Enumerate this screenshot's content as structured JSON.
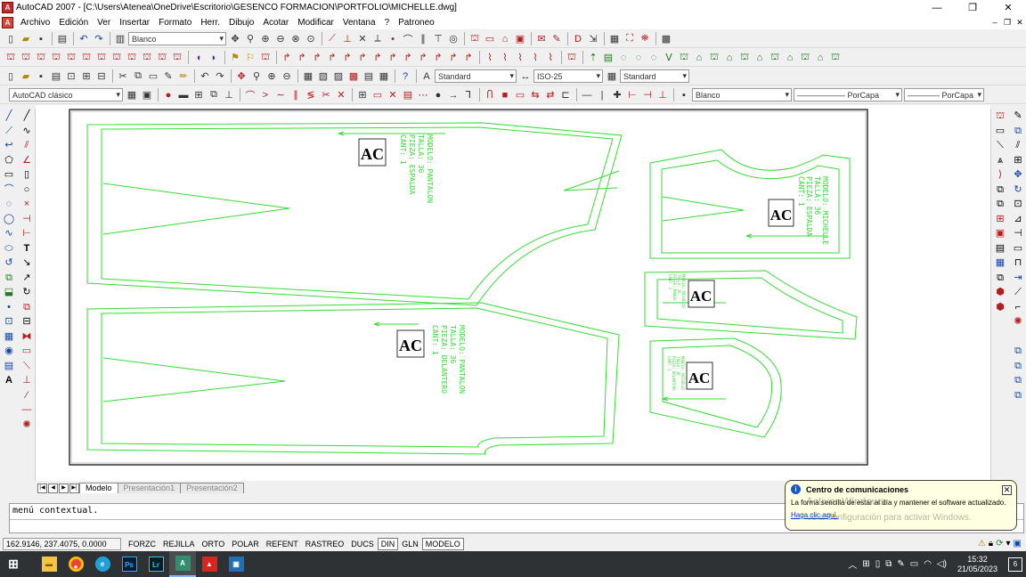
{
  "window": {
    "title": "AutoCAD 2007 - [C:\\Users\\Atenea\\OneDrive\\Escritorio\\GESENCO FORMACION\\PORTFOLIO\\MICHELLE.dwg]",
    "minimize": "—",
    "maximize": "❐",
    "close": "✕"
  },
  "menu": {
    "items": [
      "Archivo",
      "Edición",
      "Ver",
      "Insertar",
      "Formato",
      "Herr.",
      "Dibujo",
      "Acotar",
      "Modificar",
      "Ventana",
      "?",
      "Patroneo"
    ],
    "doc_controls": [
      "–",
      "❐",
      "✕"
    ]
  },
  "toolbar1": {
    "color_combo": "Blanco"
  },
  "toolbar3": {
    "text_style": "Standard",
    "dim_style": "ISO-25",
    "table_style": "Standard"
  },
  "toolbar4": {
    "workspace": "AutoCAD clásico",
    "layer_color": "Blanco",
    "linetype": "——————  PorCapa",
    "lineweight": "————  PorCapa"
  },
  "drawing": {
    "line_color": "#33dd33",
    "logo_text": "AC",
    "pieces": {
      "back_pants": [
        "MODELO: PANTALON",
        "TALLA: 36",
        "PIEZA: ESPALDA",
        "CANT: 1"
      ],
      "front_pants": [
        "MODELO: PANTALON",
        "TALLA: 36",
        "PIEZA: DELANTERO",
        "CANT: 1"
      ],
      "back_blouse": [
        "MODELO: MICHELLE",
        "TALLA: 36",
        "PIEZA: ESPALDA",
        "CANT: 1"
      ],
      "sleeve": [
        "MODELO: MICHELLE",
        "TALLA: 36",
        "PIEZA: MANGA",
        "CANT: 2"
      ],
      "front_blouse": [
        "MODELO: MICHELLE",
        "TALLA: 36",
        "PIEZA: DELANTERO",
        "CANT: 1"
      ]
    }
  },
  "layout_tabs": [
    "Modelo",
    "Presentación1",
    "Presentación2"
  ],
  "command_line": {
    "text": "menú contextual."
  },
  "status": {
    "coords": "162.9146, 237.4075, 0.0000",
    "buttons": [
      "FORZC",
      "REJILLA",
      "ORTO",
      "POLAR",
      "REFENT",
      "RASTREO",
      "DUCS",
      "DIN",
      "GLN",
      "MODELO"
    ]
  },
  "balloon": {
    "title": "Centro de comunicaciones",
    "body": "La forma sencilla de estar al día y mantener el software actualizado.",
    "link": "Haga clic aquí."
  },
  "watermark": {
    "line1": "Activar Windows",
    "line2": "Ve a Configuración para activar Windows."
  },
  "taskbar": {
    "apps": [
      {
        "name": "start",
        "label": "⊞",
        "color": "#ffffff"
      },
      {
        "name": "explorer",
        "label": "▬",
        "color": "#f5c342"
      },
      {
        "name": "chrome",
        "label": "●",
        "color": "#ea4335"
      },
      {
        "name": "edge",
        "label": "e",
        "color": "#1fa0d8"
      },
      {
        "name": "photoshop",
        "label": "Ps",
        "color": "#001e36"
      },
      {
        "name": "lightroom",
        "label": "Lr",
        "color": "#001d26"
      },
      {
        "name": "autocad",
        "label": "A",
        "color": "#2f8f6f"
      },
      {
        "name": "acrobat",
        "label": "▲",
        "color": "#d8261c"
      },
      {
        "name": "photos",
        "label": "▣",
        "color": "#1f6fb5"
      }
    ],
    "time": "15:32",
    "date": "21/05/2023",
    "notifications": "6"
  }
}
